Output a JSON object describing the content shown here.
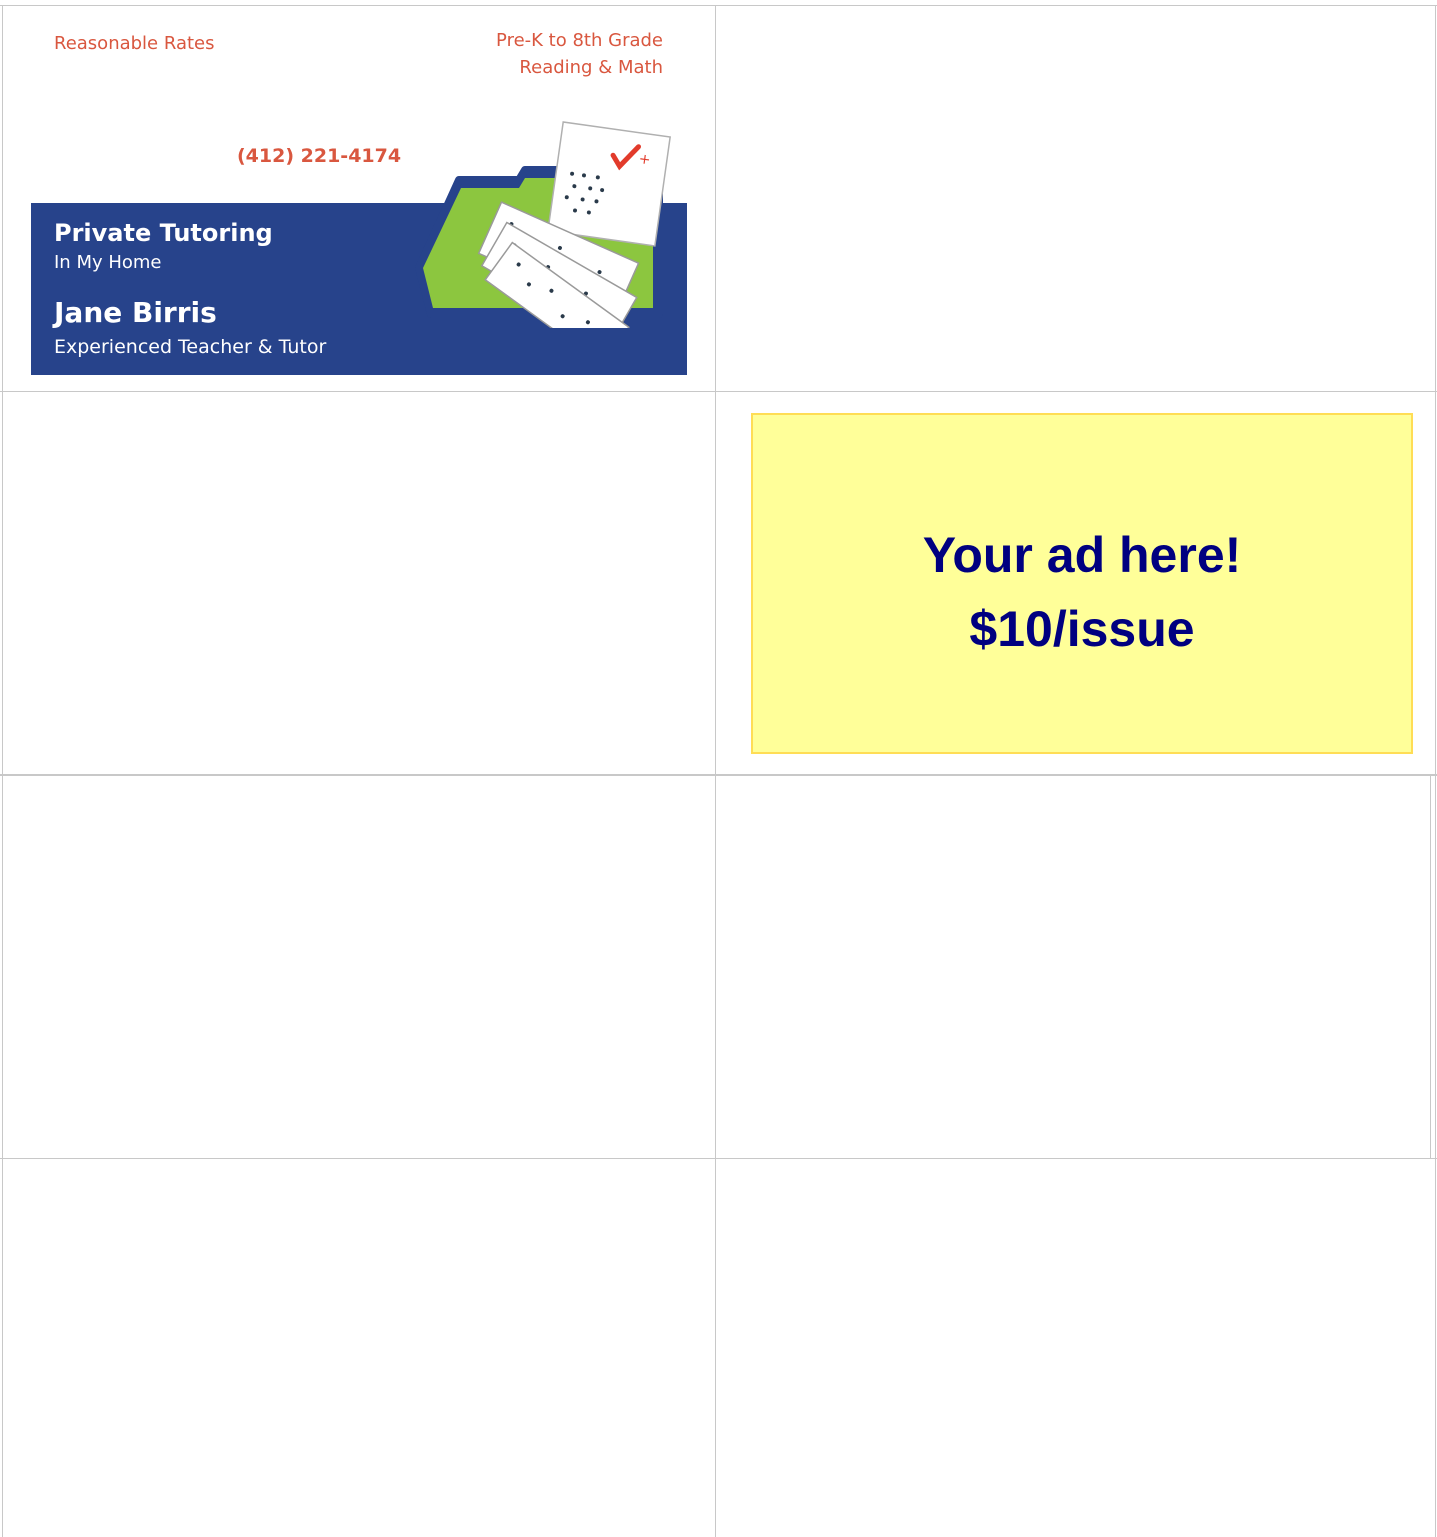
{
  "business_card": {
    "top_left": "Reasonable Rates",
    "top_right_line1": "Pre-K to 8th Grade",
    "top_right_line2": "Reading & Math",
    "phone": "(412) 221-4174",
    "service_title": "Private Tutoring",
    "service_subtitle": "In My Home",
    "name": "Jane Birris",
    "credential": "Experienced Teacher & Tutor",
    "colors": {
      "accent_red": "#d9573f",
      "band_blue": "#27438b",
      "folder_green": "#8cc63f"
    },
    "illustration": "graded-test-papers-in-folder-icon"
  },
  "ad_placeholder": {
    "line1": "Your ad here!",
    "line2": "$10/issue",
    "colors": {
      "background": "#ffff99",
      "text": "#000080"
    }
  }
}
